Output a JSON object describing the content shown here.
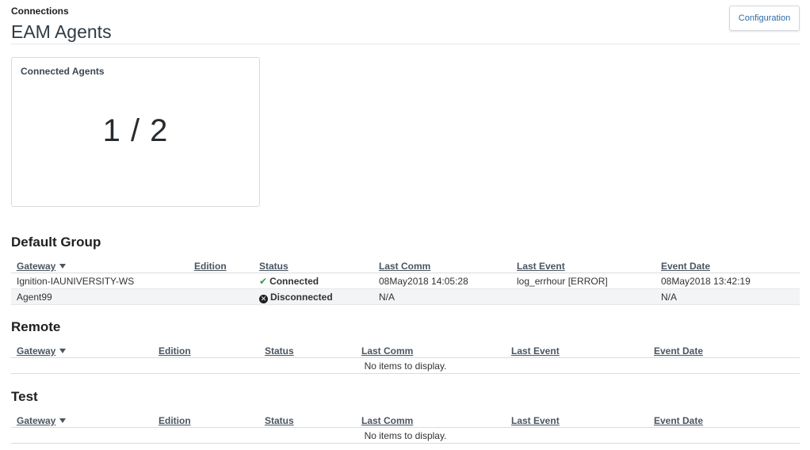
{
  "header": {
    "breadcrumb": "Connections",
    "title": "EAM Agents",
    "config_button": "Configuration"
  },
  "summary_card": {
    "title": "Connected Agents",
    "value": "1 / 2"
  },
  "groups": [
    {
      "name": "Default Group",
      "columns": [
        "Gateway",
        "Edition",
        "Status",
        "Last Comm",
        "Last Event",
        "Event Date"
      ],
      "rows": [
        {
          "gateway": "Ignition-IAUNIVERSITY-WS",
          "edition": "",
          "status": "Connected",
          "status_icon": "check-icon",
          "last_comm": "08May2018 14:05:28",
          "last_event": "log_errhour [ERROR]",
          "event_date": "08May2018 13:42:19"
        },
        {
          "gateway": "Agent99",
          "edition": "",
          "status": "Disconnected",
          "status_icon": "x-circle-icon",
          "last_comm": "N/A",
          "last_event": "",
          "event_date": "N/A"
        }
      ],
      "empty_text": ""
    },
    {
      "name": "Remote",
      "columns": [
        "Gateway",
        "Edition",
        "Status",
        "Last Comm",
        "Last Event",
        "Event Date"
      ],
      "rows": [],
      "empty_text": "No items to display."
    },
    {
      "name": "Test",
      "columns": [
        "Gateway",
        "Edition",
        "Status",
        "Last Comm",
        "Last Event",
        "Event Date"
      ],
      "rows": [],
      "empty_text": "No items to display."
    }
  ],
  "colors": {
    "connected": "#2e9e3e",
    "link": "#2f6aa3",
    "row_alt": "#f3f4f6"
  }
}
